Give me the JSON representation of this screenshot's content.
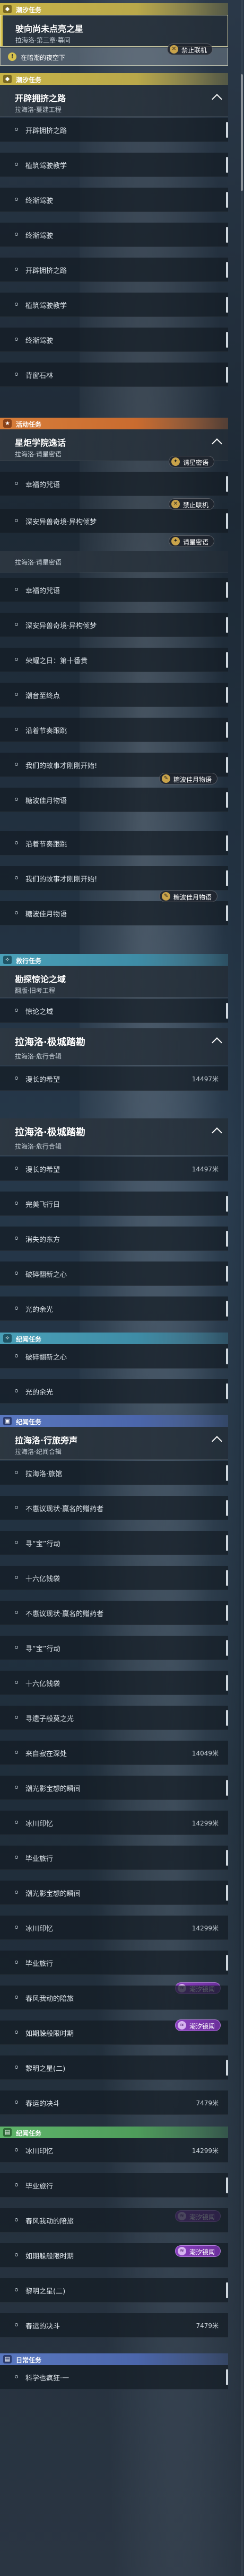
{
  "main_quest": {
    "header": "潮汐任务",
    "card1": {
      "title": "驶向尚未点亮之星",
      "sub": "拉海洛·第三章·幕间"
    },
    "notice": "在暗潮的夜空下",
    "badge": "禁止联机"
  },
  "main_quest2": {
    "header": "潮汐任务",
    "card": {
      "title": "开辟拥挤之路",
      "sub": "拉海洛·蔓建工程"
    },
    "items": [
      "开辟拥挤之路",
      "植筑驾驶教学",
      "终渐驾驶",
      "终渐驾驶",
      "开辟拥挤之路",
      "植筑驾驶教学",
      "终渐驾驶",
      "背窗石林"
    ]
  },
  "event_quest": {
    "header": "活动任务",
    "card": {
      "title": "星炬学院逸话",
      "sub": "拉海洛·请星密语"
    },
    "items": [
      "幸福的咒语",
      "深安异兽奇境·异构倾梦",
      "荣耀之日：第十番贵",
      "潮音至终点",
      "沿着节奏跟跳",
      "我们的故事才刚刚开始!",
      "糖波佳月物语",
      "幸福的咒语",
      "深安异兽奇境·异构倾梦",
      "荣耀之日：第十番贵",
      "潮音至终点",
      "沿着节奏跟跳",
      "我们的故事才刚刚开始!",
      "糖波佳月物语"
    ],
    "sub2": "拉海洛·请星密语",
    "badges": {
      "secret": "请星密语",
      "no_coop": "禁止联机",
      "story": "糖波佳月物语"
    }
  },
  "side_quest": {
    "header": "救行任务",
    "card1": {
      "title": "勘探惊论之域",
      "sub": "翻版·旧考工程"
    },
    "item_a": "惊论之域",
    "card2": {
      "title": "拉海洛·极城踏勘",
      "sub": "拉海洛·危行合辑"
    },
    "items": [
      "漫长的希望",
      "漫长的希望",
      "完美飞行日",
      "消失的东方",
      "破碎翻新之心",
      "光的余光",
      "破碎翻新之心",
      "光的余光"
    ],
    "distances": [
      "14497米",
      "14497米"
    ]
  },
  "daily_quest": {
    "header": "纪闻任务",
    "card": {
      "title": "拉海洛·行旅旁声",
      "sub": "拉海洛·纪闻合辑"
    },
    "items": [
      "拉海洛·旅馆",
      "不惠议现状·赢名的赠药者",
      "寻“宝”行动",
      "十六亿钱袋",
      "不惠议现状·赢名的赠药者",
      "寻“宝”行动",
      "十六亿钱袋",
      "寻遗子般莫之光",
      "来自寂在深处",
      "潮光影宝想的瞬间",
      "冰川印忆",
      "毕业旅行",
      "潮光影宝想的瞬间",
      "冰川印忆",
      "毕业旅行",
      "春风我动的陪旅",
      "如期躲般限时期",
      "黎明之星(二)",
      "春运的决斗"
    ],
    "distances": [
      "14049米",
      "14299米",
      "14299米",
      "7479米",
      "7479米"
    ]
  },
  "world_quest": {
    "header": "日常任务",
    "items": [
      "冰川印忆",
      "毕业旅行",
      "春风我动的陪旅",
      "如期躲般限时期",
      "黎明之星(二)",
      "春运的决斗",
      "科学也疯狂·一"
    ],
    "badges": {
      "tide": "潮汐镜阈"
    }
  }
}
